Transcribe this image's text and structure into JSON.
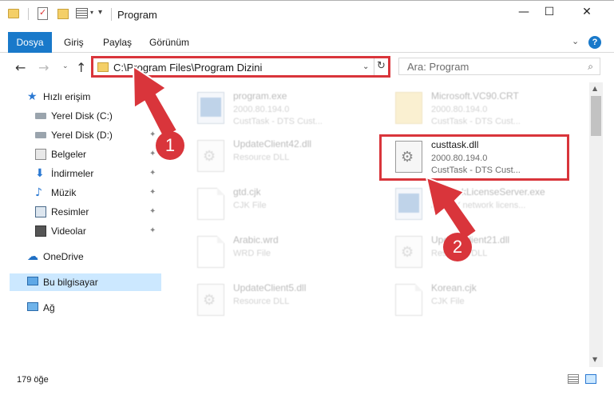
{
  "window": {
    "title": "Program",
    "minimize": "—",
    "maximize": "☐",
    "close": "✕"
  },
  "ribbon": {
    "tabs": [
      "Dosya",
      "Giriş",
      "Paylaş",
      "Görünüm"
    ],
    "expand_icon": "chevron-down",
    "help": "?"
  },
  "navigation": {
    "back": "←",
    "forward": "→",
    "recent": "⌄",
    "up": "↑",
    "address": "C:\\Program Files\\Program Dizini",
    "address_dropdown": "⌄",
    "refresh": "↻",
    "search_placeholder": "Ara: Program"
  },
  "sidebar": {
    "items": [
      {
        "label": "Hızlı erişim",
        "icon": "star-icon"
      },
      {
        "label": "Yerel Disk (C:)",
        "icon": "drive-icon"
      },
      {
        "label": "Yerel Disk (D:)",
        "icon": "drive-icon"
      },
      {
        "label": "Belgeler",
        "icon": "documents-icon"
      },
      {
        "label": "İndirmeler",
        "icon": "download-icon"
      },
      {
        "label": "Müzik",
        "icon": "music-icon"
      },
      {
        "label": "Resimler",
        "icon": "pictures-icon"
      },
      {
        "label": "Videolar",
        "icon": "video-icon"
      },
      {
        "label": "OneDrive",
        "icon": "cloud-icon"
      },
      {
        "label": "Bu bilgisayar",
        "icon": "computer-icon"
      },
      {
        "label": "Ağ",
        "icon": "network-icon"
      }
    ]
  },
  "files": [
    {
      "name": "program.exe",
      "line2": "2000.80.194.0",
      "line3": "CustTask - DTS Cust...",
      "icon": "exe"
    },
    {
      "name": "Microsoft.VC90.CRT",
      "line2": "2000.80.194.0",
      "line3": "CustTask - DTS Cust...",
      "icon": "folder"
    },
    {
      "name": "UpdateClient42.dll",
      "line2": "Resource DLL",
      "line3": "",
      "icon": "gear"
    },
    {
      "name": "custtask.dll",
      "line2": "2000.80.194.0",
      "line3": "CustTask - DTS Cust...",
      "icon": "gear"
    },
    {
      "name": "gtd.cjk",
      "line2": "CJK File",
      "line3": "",
      "icon": "page"
    },
    {
      "name": "NetworkLicenseServer.exe",
      "line2": "ABBYY network licens...",
      "line3": "",
      "icon": "exe"
    },
    {
      "name": "Arabic.wrd",
      "line2": "WRD File",
      "line3": "",
      "icon": "page"
    },
    {
      "name": "UpdateClient21.dll",
      "line2": "Resource DLL",
      "line3": "",
      "icon": "gear"
    },
    {
      "name": "UpdateClient5.dll",
      "line2": "Resource DLL",
      "line3": "",
      "icon": "gear"
    },
    {
      "name": "Korean.cjk",
      "line2": "CJK File",
      "line3": "",
      "icon": "page"
    }
  ],
  "annotations": {
    "step1": "1",
    "step2": "2",
    "color": "#d9353b"
  },
  "status": {
    "item_count": "179 öğe"
  },
  "colors": {
    "accent": "#1979ca",
    "selection": "#cce8ff",
    "highlight": "#d9353b"
  }
}
